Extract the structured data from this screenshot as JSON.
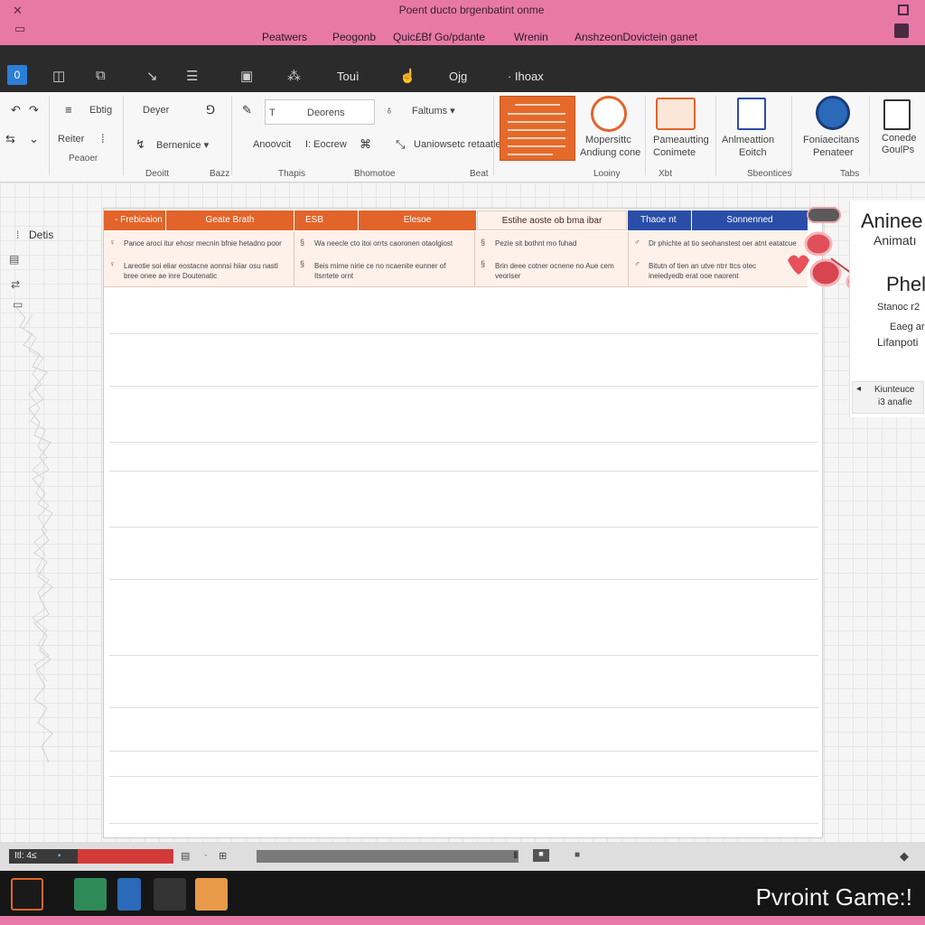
{
  "window": {
    "title": "Poent ducto brgenbatint onme",
    "menu": [
      "Peatwers",
      "Peogonb",
      "Quic£Bf Go/pdante",
      "Wrenin",
      "AnshzeonDovictein ganet"
    ]
  },
  "tabs": {
    "active_icon": "0",
    "items": [
      "Touì",
      "Ojg",
      "· Ihoax"
    ]
  },
  "ribbon": {
    "clipboard": {
      "l1": "Ebtig",
      "l2": "Reiter",
      "l3": "Peaoer"
    },
    "design": {
      "l1": "Deyer",
      "l2": "Bernenice ▾",
      "group": "Deoitt"
    },
    "font": {
      "box_prefix": "T",
      "box_value": "Deorens",
      "l3": "Anoovcit",
      "l4": "I: Eocrew",
      "group1": "Bazz",
      "group2": "Thapis"
    },
    "paragraph": {
      "l1": "Faltums ▾",
      "l2": "Uaniowsetc retaatle",
      "group": "Bhomotoe"
    },
    "styles": {
      "group": "Beat"
    },
    "commands": [
      {
        "label1": "Mopersittc",
        "label2": "Andiung cone"
      },
      {
        "label1": "Pameautting",
        "label2": "Conimete"
      },
      {
        "label1": "Anlmeattion",
        "label2": "Eoitch"
      },
      {
        "label1": "Foniaecitans",
        "label2": "Penateer"
      },
      {
        "label1": "Conede",
        "label2": "GoulPs"
      }
    ],
    "groups_right": [
      "Looiny",
      "Xbt",
      "Sbeontices",
      "Tabs"
    ]
  },
  "left_panel": {
    "label": "Detis"
  },
  "document": {
    "headers": [
      {
        "text": "- Frebicaion",
        "color": "#e2642a"
      },
      {
        "text": "Geate Brath",
        "color": "#e2642a"
      },
      {
        "text": "ESB",
        "color": "#e2642a"
      },
      {
        "text": "Elesoe",
        "color": "#e2642a"
      },
      {
        "text": "Estihe aoste ob bma ibar",
        "color": "#fdf1ea"
      },
      {
        "text": "Thaoe nt",
        "color": "#2a4ea8"
      },
      {
        "text": "Sonnenned",
        "color": "#2a4ea8"
      }
    ],
    "cells": [
      {
        "line1": "Pance aroci itur ehosr mecnin bfnie hetadno poor",
        "line2": "Lareotie soi eliar eostacne aonnsi hiiar osu nastl bree onee ae inre Doutenatic"
      },
      {
        "line1": "Wa neecle cto itoi orrts caoronen otaolgiost",
        "line2": "Beis mirne nirie ce no ncaenite eunner of Itsrrtete ornt"
      },
      {
        "line1": "Pezie sit bothnt mo fuhad",
        "line2": "Brin deee cotner ocnene no Aue cem veoriser"
      },
      {
        "line1": "Dr phichte at tio seohanstest oer atnt eatatcue",
        "line2": "Bitutn of tien an utve ntrr ttcs otec ineiedyedb erat ooe naorent"
      }
    ]
  },
  "right_panel": {
    "title": "Aninee",
    "subtitle": "Animatı",
    "big": "Phel",
    "s1": "Stanoc r2",
    "s2": "Eaeg ar",
    "s3": "Lifanpoti",
    "box_l1": "Kiunteuce",
    "box_l2": "i3 anafie"
  },
  "status": {
    "left": "Itl: 4≤",
    "zoom": "■"
  },
  "taskbar": {
    "brand": "Pvroint Game:!"
  },
  "colors": {
    "titlebar": "#e879a6",
    "accent_orange": "#e2642a",
    "accent_blue": "#2a4ea8",
    "tabsbar": "#2b2b2b",
    "taskbar": "#151515"
  }
}
